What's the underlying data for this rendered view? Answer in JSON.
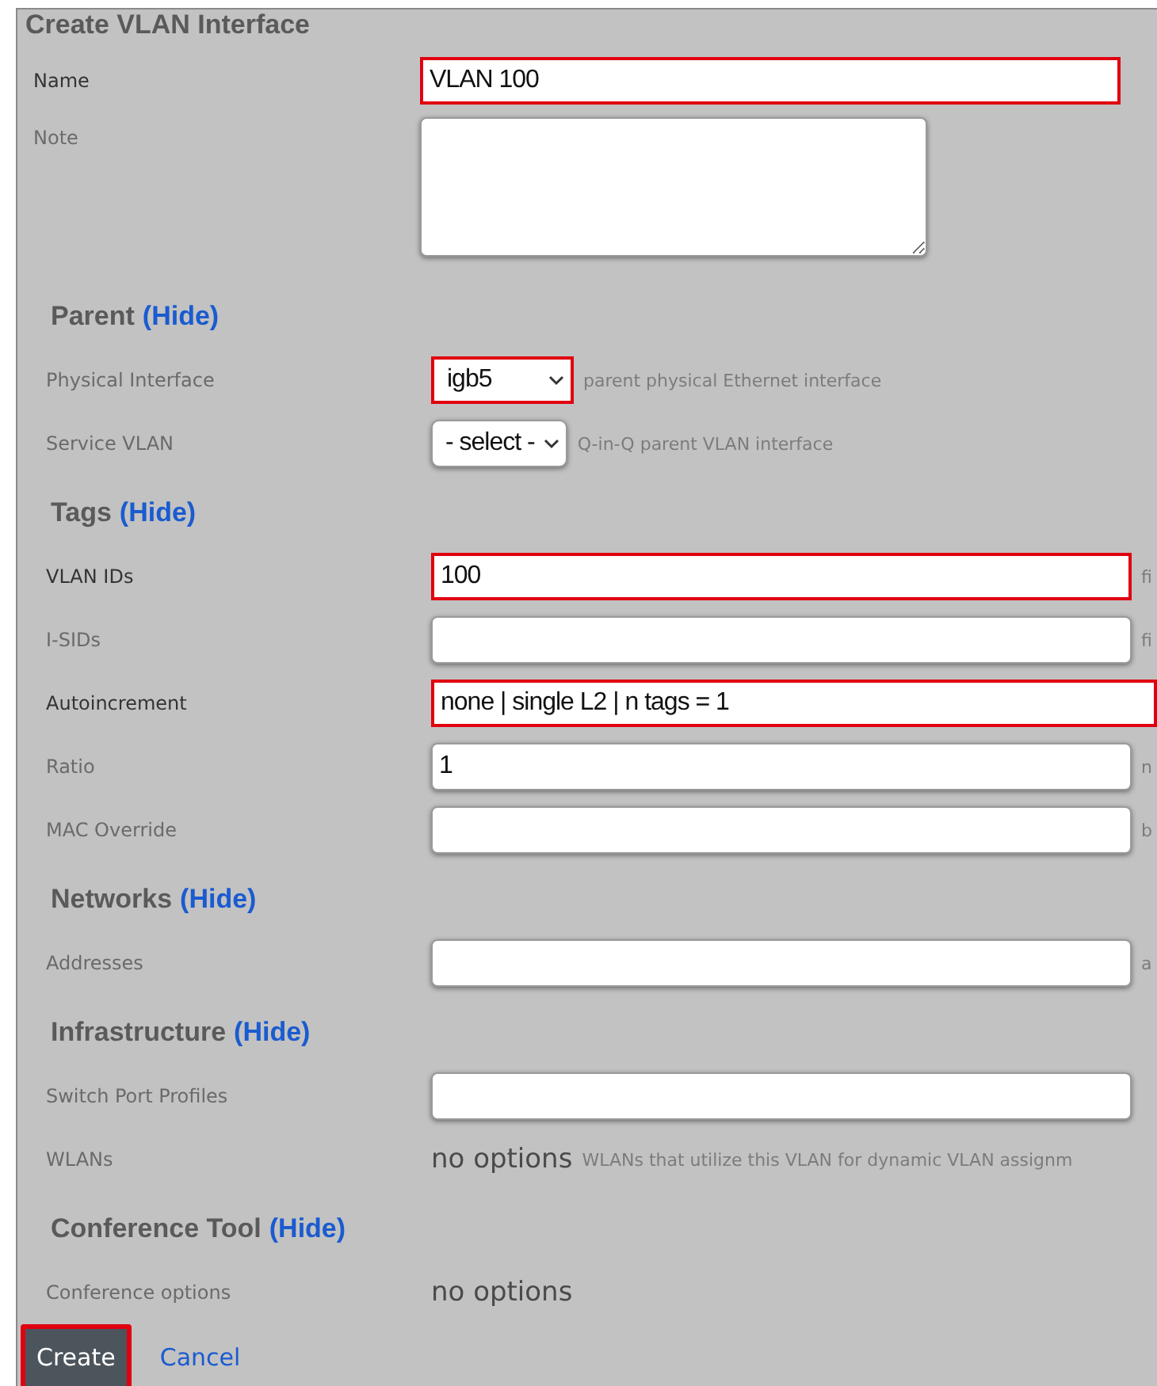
{
  "form": {
    "title": "Create VLAN Interface",
    "fields": [
      {
        "kind": "text",
        "label": "Name",
        "value": "VLAN 100",
        "required": true,
        "highlighted": true
      },
      {
        "kind": "textarea",
        "label": "Note",
        "required": false,
        "highlighted": false
      }
    ]
  },
  "sections": [
    {
      "title": "Parent",
      "toggle": "(Hide)",
      "fields": [
        {
          "kind": "select",
          "label": "Physical Interface",
          "value": "igb5",
          "hint": "parent physical Ethernet interface",
          "required": false,
          "highlighted": true
        },
        {
          "kind": "select",
          "label": "Service VLAN",
          "value": "- select -",
          "hint": "Q-in-Q parent VLAN interface",
          "required": false,
          "highlighted": false
        }
      ]
    },
    {
      "title": "Tags",
      "toggle": "(Hide)",
      "fields": [
        {
          "kind": "text",
          "label": "VLAN IDs",
          "value": "100",
          "hint": "fi",
          "required": true,
          "highlighted": true
        },
        {
          "kind": "text",
          "label": "I-SIDs",
          "hint": "fi",
          "required": false,
          "highlighted": false
        },
        {
          "kind": "wide",
          "label": "Autoincrement",
          "value": "none | single L2 | n tags = 1",
          "required": true,
          "highlighted": true
        },
        {
          "kind": "text",
          "label": "Ratio",
          "value": "1",
          "hint": "n",
          "required": false,
          "highlighted": false
        },
        {
          "kind": "text",
          "label": "MAC Override",
          "hint": "b",
          "required": false,
          "highlighted": false
        }
      ]
    },
    {
      "title": "Networks",
      "toggle": "(Hide)",
      "fields": [
        {
          "kind": "text",
          "label": "Addresses",
          "hint": "a",
          "required": false,
          "highlighted": false
        }
      ]
    },
    {
      "title": "Infrastructure",
      "toggle": "(Hide)",
      "fields": [
        {
          "kind": "text",
          "label": "Switch Port Profiles",
          "required": false,
          "highlighted": false
        },
        {
          "kind": "static",
          "label": "WLANs",
          "value": "no options",
          "hint": "WLANs that utilize this VLAN for dynamic VLAN assignm",
          "required": false
        }
      ]
    },
    {
      "title": "Conference Tool",
      "toggle": "(Hide)",
      "fields": [
        {
          "kind": "static",
          "label": "Conference options",
          "value": "no options",
          "required": false
        }
      ]
    }
  ],
  "actions": {
    "submit": {
      "label": "Create",
      "highlighted": true
    },
    "cancel": {
      "label": "Cancel"
    }
  }
}
